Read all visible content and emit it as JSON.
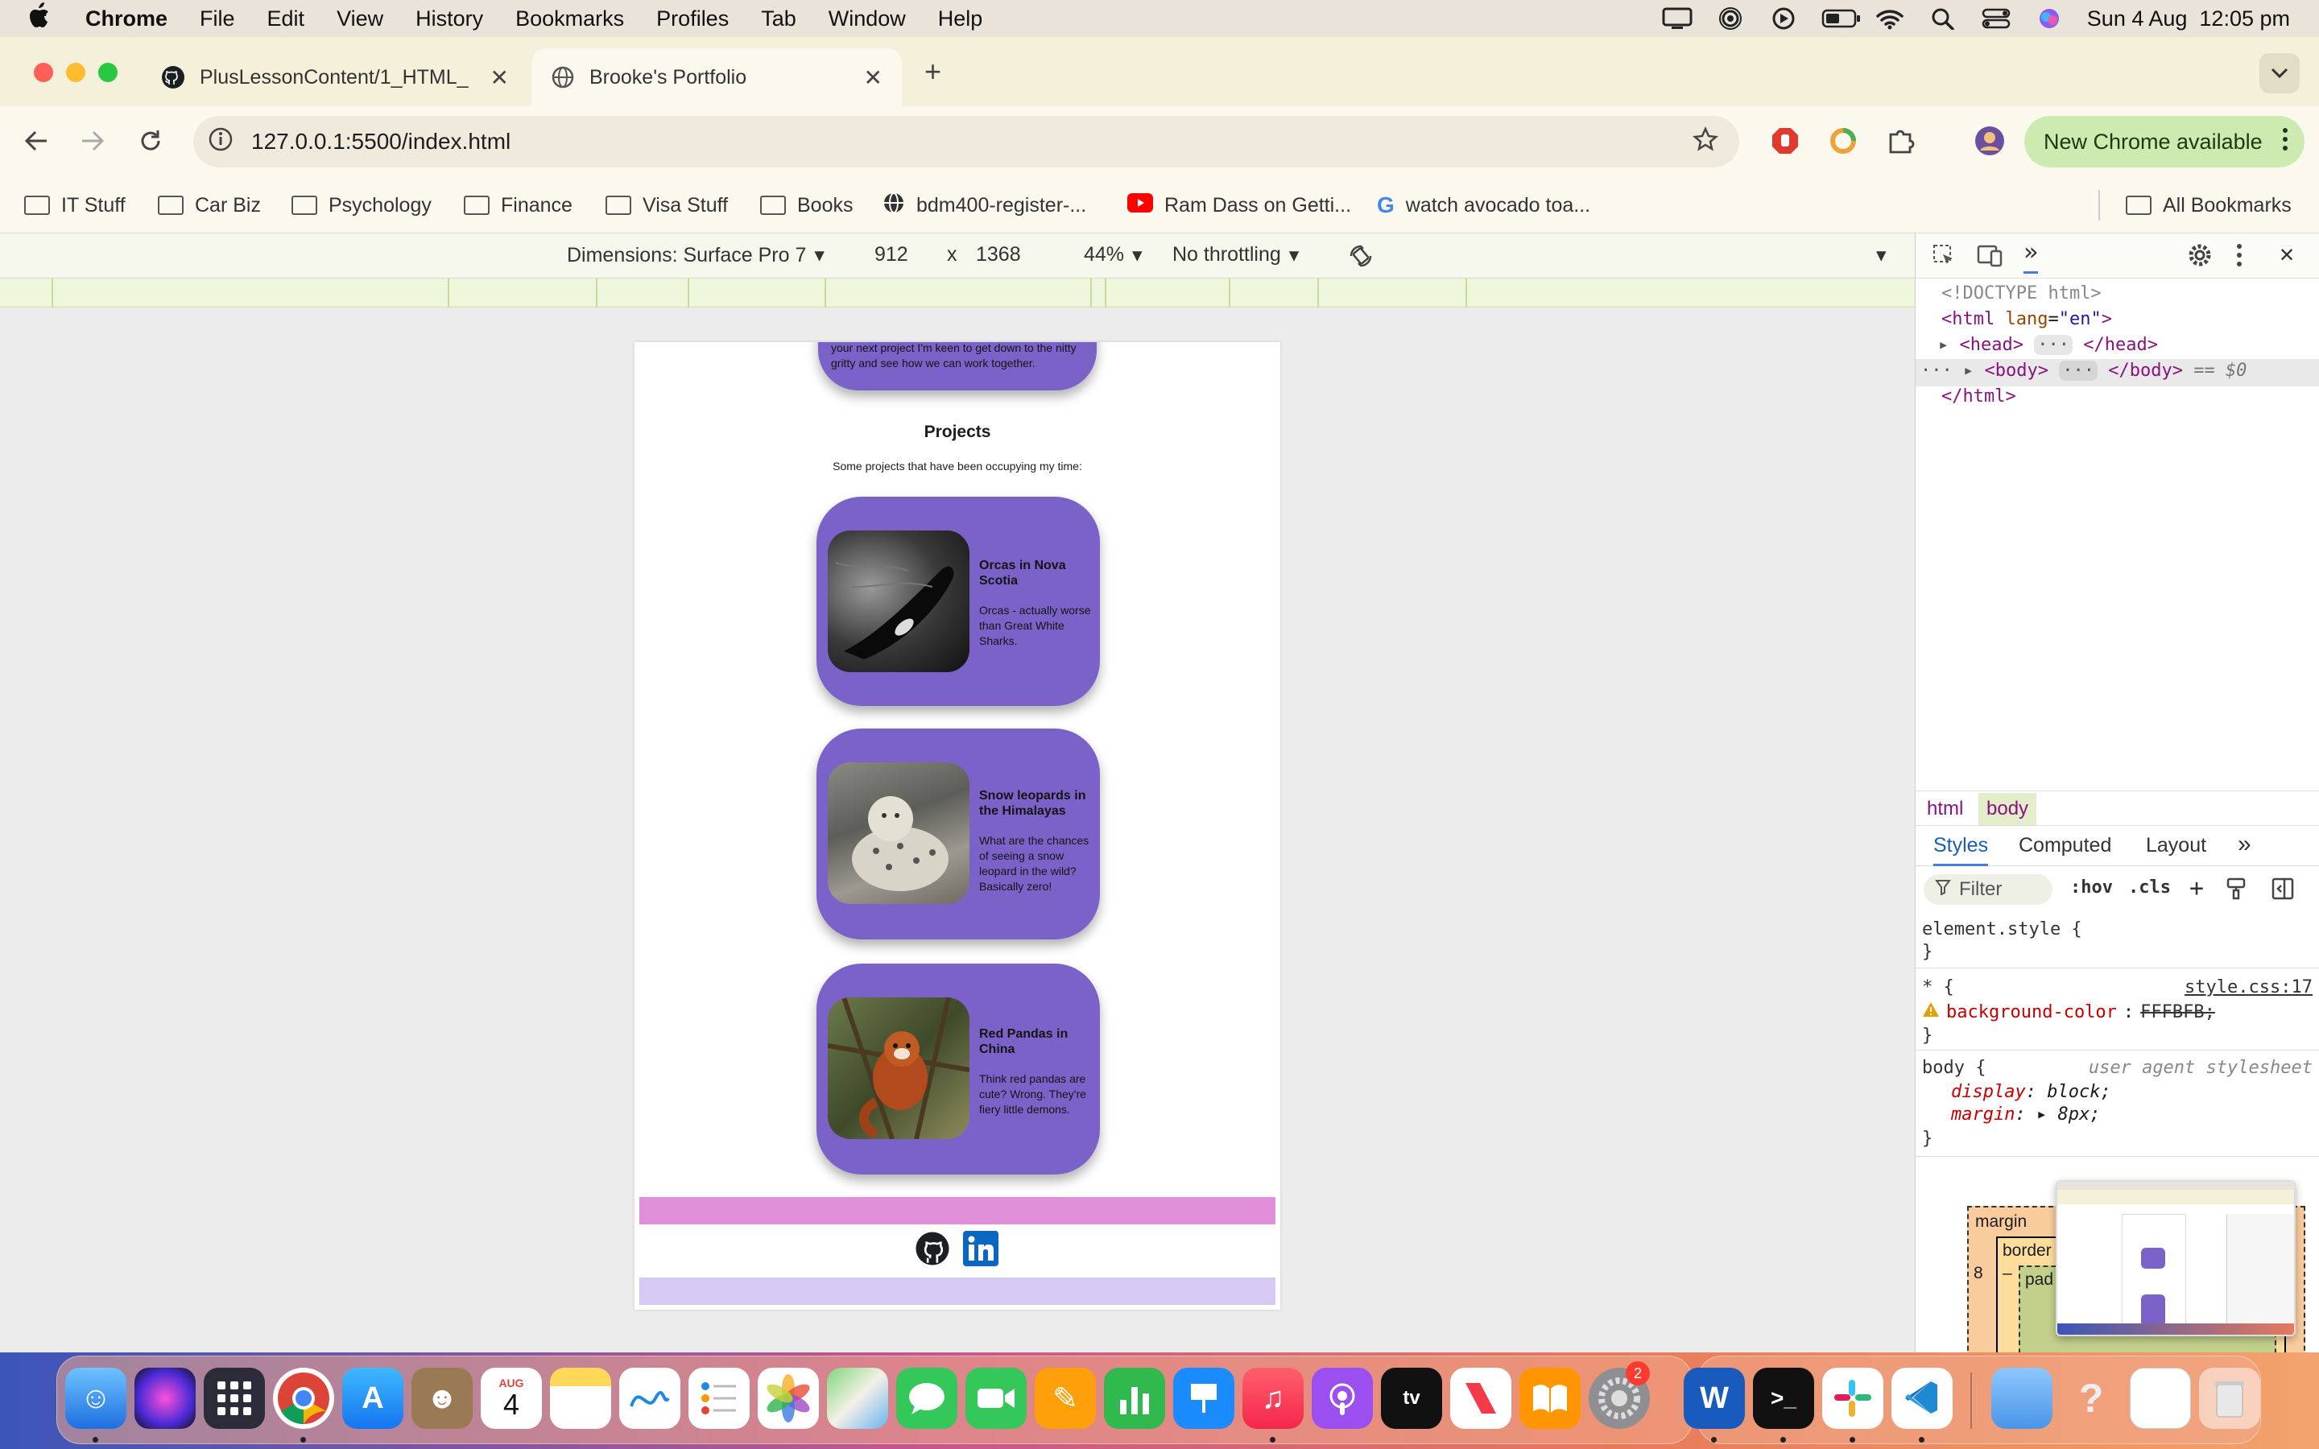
{
  "menubar": {
    "app": "Chrome",
    "items": [
      "File",
      "Edit",
      "View",
      "History",
      "Bookmarks",
      "Profiles",
      "Tab",
      "Window",
      "Help"
    ],
    "datetime": "Sun 4 Aug  12:05 pm"
  },
  "tabs": [
    {
      "title": "PlusLessonContent/1_HTML_",
      "close": "✕"
    },
    {
      "title": "Brooke's Portfolio",
      "close": "✕"
    }
  ],
  "toolbar": {
    "url": "127.0.0.1:5500/index.html",
    "update_label": "New Chrome available"
  },
  "bookmarks": [
    {
      "label": "IT Stuff",
      "icon": "folder-icon"
    },
    {
      "label": "Car Biz",
      "icon": "folder-icon"
    },
    {
      "label": "Psychology",
      "icon": "folder-icon"
    },
    {
      "label": "Finance",
      "icon": "folder-icon"
    },
    {
      "label": "Visa Stuff",
      "icon": "folder-icon"
    },
    {
      "label": "Books",
      "icon": "folder-icon"
    },
    {
      "label": "bdm400-register-...",
      "icon": "globe-icon"
    },
    {
      "label": "Ram Dass on Getti...",
      "icon": "youtube-icon"
    },
    {
      "label": "watch avocado toa...",
      "icon": "google-icon"
    },
    {
      "label": "All Bookmarks",
      "icon": "folder-icon"
    }
  ],
  "device": {
    "dimensions": "Dimensions: Surface Pro 7",
    "width": "912",
    "times": "x",
    "height": "1368",
    "zoom": "44%",
    "throttle": "No throttling"
  },
  "site": {
    "intro_text": "your next project I'm keen to get down to the nitty gritty and see how we can work together.",
    "projects_heading": "Projects",
    "projects_sub": "Some projects that have been occupying my time:",
    "cards": [
      {
        "title": "Orcas in Nova Scotia",
        "text": "Orcas - actually worse than Great White Sharks."
      },
      {
        "title": "Snow leopards in the Himalayas",
        "text": "What are the chances of seeing a snow leopard in the wild? Basically zero!"
      },
      {
        "title": "Red Pandas in China",
        "text": "Think red pandas are cute? Wrong. They're fiery little demons."
      }
    ],
    "footer_colors": {
      "top_bar": "#e08ed9",
      "bottom_bar": "#d6c9f3",
      "card": "#7b62c9"
    }
  },
  "devtools": {
    "elements": {
      "doctype": "<!DOCTYPE html>",
      "html_open": "<html lang=\"en\">",
      "head": "<head>",
      "head_close": "</head>",
      "body": "<body>",
      "body_close": "</body>",
      "body_note": "== $0",
      "html_close": "</html>",
      "ellipsis": "···"
    },
    "breadcrumbs": [
      "html",
      "body"
    ],
    "style_tabs": [
      "Styles",
      "Computed",
      "Layout"
    ],
    "filter_placeholder": "Filter",
    "hov": ":hov",
    "cls": ".cls",
    "rules": {
      "element_style": "element.style {",
      "close": "}",
      "star_selector": "* {",
      "star_source": "style.css:17",
      "bg_prop": "background-color",
      "bg_val": "FFFBFB;",
      "body_selector": "body {",
      "body_source": "user agent stylesheet",
      "display_prop": "display",
      "display_val": "block;",
      "margin_prop": "margin",
      "margin_val": "8px;"
    },
    "boxmodel": {
      "margin": "margin",
      "border": "border",
      "padding": "pad",
      "margin_value": "8",
      "dash": "–"
    }
  },
  "dock": {
    "calendar_month": "AUG",
    "calendar_day": "4",
    "settings_badge": "2"
  }
}
